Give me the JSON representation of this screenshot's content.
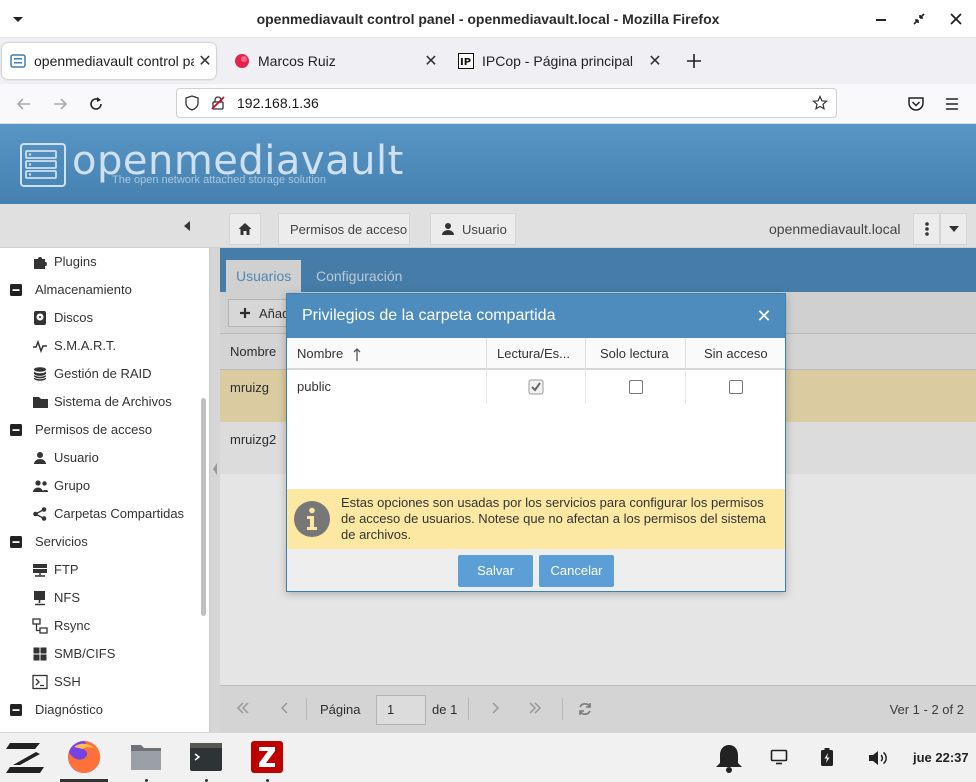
{
  "window": {
    "title": "openmediavault control panel - openmediavault.local - Mozilla Firefox"
  },
  "tabs": [
    {
      "label": "openmediavault control panel",
      "active": true
    },
    {
      "label": "Marcos Ruiz",
      "active": false
    },
    {
      "label": "IPCop - Página principal",
      "active": false
    }
  ],
  "nav": {
    "url": "192.168.1.36"
  },
  "omv": {
    "logo": "openmediavault",
    "tagline": "The open network attached storage solution",
    "breadcrumb": [
      "Permisos de acceso",
      "Usuario"
    ],
    "hostname": "openmediavault.local"
  },
  "sidebar": {
    "items": [
      {
        "label": "Plugins",
        "icon": "puzzle-icon",
        "level": 1
      },
      {
        "label": "Almacenamiento",
        "icon": "collapse-icon",
        "level": 0
      },
      {
        "label": "Discos",
        "icon": "disk-icon",
        "level": 1
      },
      {
        "label": "S.M.A.R.T.",
        "icon": "pulse-icon",
        "level": 1
      },
      {
        "label": "Gestión de RAID",
        "icon": "database-icon",
        "level": 1
      },
      {
        "label": "Sistema de Archivos",
        "icon": "folder-icon",
        "level": 1
      },
      {
        "label": "Permisos de acceso",
        "icon": "collapse-icon",
        "level": 0
      },
      {
        "label": "Usuario",
        "icon": "user-icon",
        "level": 1
      },
      {
        "label": "Grupo",
        "icon": "group-icon",
        "level": 1
      },
      {
        "label": "Carpetas Compartidas",
        "icon": "share-icon",
        "level": 1
      },
      {
        "label": "Servicios",
        "icon": "collapse-icon",
        "level": 0
      },
      {
        "label": "FTP",
        "icon": "server-icon",
        "level": 1
      },
      {
        "label": "NFS",
        "icon": "monitor-icon",
        "level": 1
      },
      {
        "label": "Rsync",
        "icon": "network-icon",
        "level": 1
      },
      {
        "label": "SMB/CIFS",
        "icon": "windows-icon",
        "level": 1
      },
      {
        "label": "SSH",
        "icon": "terminal-icon",
        "level": 1
      },
      {
        "label": "Diagnóstico",
        "icon": "collapse-icon",
        "level": 0
      }
    ]
  },
  "main": {
    "tabs": [
      "Usuarios",
      "Configuración"
    ],
    "add_label": "Añad",
    "column_header": "Nombre",
    "rows": [
      "mruizg",
      "mruizg2"
    ],
    "pager": {
      "page_label": "Página",
      "page_value": "1",
      "of_label": "de 1",
      "summary": "Ver 1 - 2 of 2"
    }
  },
  "dialog": {
    "title": "Privilegios de la carpeta compartida",
    "columns": [
      "Nombre",
      "Lectura/Es...",
      "Solo lectura",
      "Sin acceso"
    ],
    "rows": [
      {
        "name": "public",
        "read_write": true,
        "read_only": false,
        "no_access": false
      }
    ],
    "info": "Estas opciones son usadas por los servicios para configurar los permisos de acceso de usuarios. Notese que no afectan a los permisos del sistema de archivos.",
    "save_label": "Salvar",
    "cancel_label": "Cancelar"
  },
  "taskbar": {
    "clock": "jue 22:37"
  },
  "colors": {
    "omv_blue": "#4d8cbc",
    "selected_row": "#f3e3b4",
    "info_bg": "#fce8a3",
    "button_blue": "#5b9fd6"
  }
}
